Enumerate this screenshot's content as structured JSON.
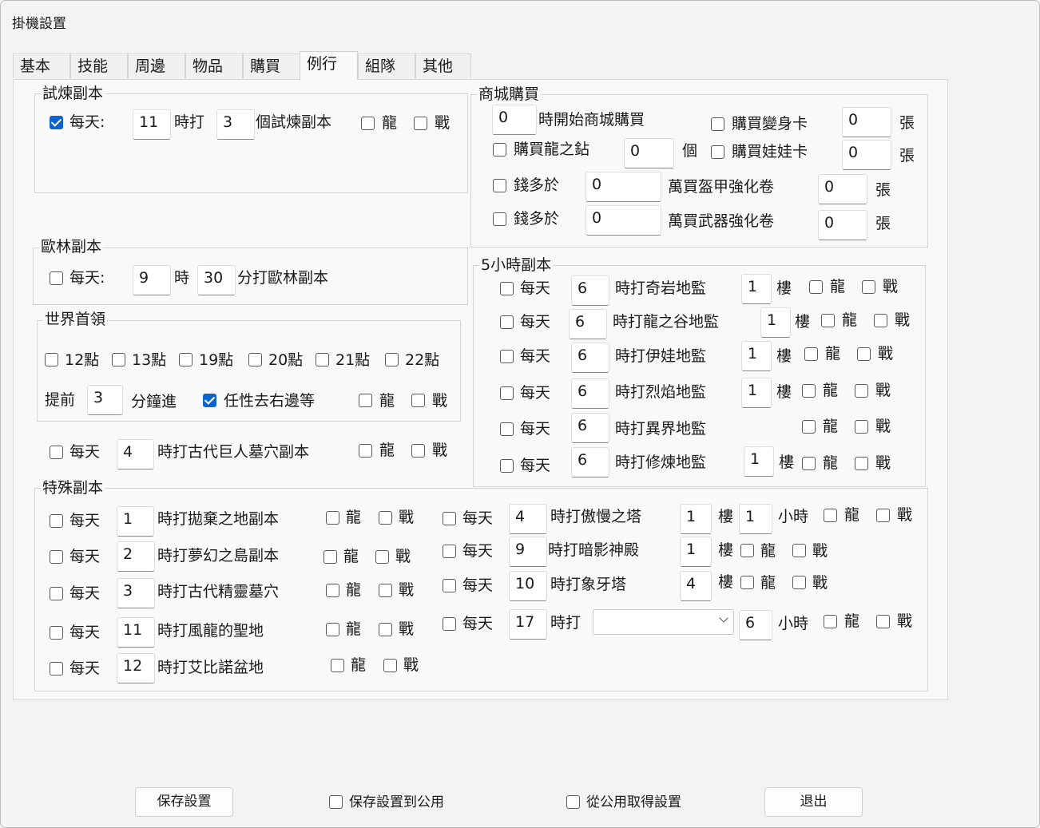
{
  "window": {
    "title": "掛機設置"
  },
  "tabs": [
    "基本",
    "技能",
    "周邊",
    "物品",
    "購買",
    "例行",
    "組隊",
    "其他"
  ],
  "trial": {
    "title": "試煉副本",
    "daily_label": "每天:",
    "daily_checked": true,
    "hour": "11",
    "mid": "時打",
    "count": "3",
    "suffix": "個試煉副本",
    "dragon": "龍",
    "war": "戰"
  },
  "orin": {
    "title": "歐林副本",
    "daily_label": "每天:",
    "hour": "9",
    "shi": "時",
    "minute": "30",
    "suffix": "分打歐林副本"
  },
  "world_boss": {
    "title": "世界首領",
    "times": [
      "12點",
      "13點",
      "19點",
      "20點",
      "21點",
      "22點"
    ],
    "advance_label": "提前",
    "advance_min": "3",
    "advance_suffix": "分鐘進",
    "random_label": "任性去右邊等",
    "random_checked": true,
    "dragon": "龍",
    "war": "戰"
  },
  "giant": {
    "daily": "每天",
    "hour": "4",
    "text": "時打古代巨人墓穴副本",
    "dragon": "龍",
    "war": "戰"
  },
  "shop": {
    "title": "商城購買",
    "start_hour": "0",
    "start_text": "時開始商城購買",
    "buy_transform": "購買變身卡",
    "transform_qty": "0",
    "zhang": "張",
    "buy_diamond": "購買龍之鉆",
    "diamond_qty": "0",
    "ge": "個",
    "buy_doll": "購買娃娃卡",
    "doll_qty": "0",
    "money_more": "錢多於",
    "armor_money": "0",
    "armor_text": "萬買盔甲強化卷",
    "armor_qty": "0",
    "weapon_money": "0",
    "weapon_text": "萬買武器強化卷",
    "weapon_qty": "0"
  },
  "five_hour": {
    "title": "5小時副本",
    "daily": "每天",
    "floor": "樓",
    "dragon": "龍",
    "war": "戰",
    "rows": [
      {
        "hour": "6",
        "text": "時打奇岩地監",
        "floor_val": "1"
      },
      {
        "hour": "6",
        "text": "時打龍之谷地監",
        "floor_val": "1"
      },
      {
        "hour": "6",
        "text": "時打伊娃地監",
        "floor_val": "1"
      },
      {
        "hour": "6",
        "text": "時打烈焰地監",
        "floor_val": "1"
      },
      {
        "hour": "6",
        "text": "時打異界地監",
        "floor_val": ""
      },
      {
        "hour": "6",
        "text": "時打修煉地監",
        "floor_val": "1"
      }
    ]
  },
  "special": {
    "title": "特殊副本",
    "daily": "每天",
    "dragon": "龍",
    "war": "戰",
    "floor": "樓",
    "hours_unit": "小時",
    "left": [
      {
        "hour": "1",
        "text": "時打拋棄之地副本"
      },
      {
        "hour": "2",
        "text": "時打夢幻之島副本"
      },
      {
        "hour": "3",
        "text": "時打古代精靈墓穴"
      },
      {
        "hour": "11",
        "text": "時打風龍的聖地"
      },
      {
        "hour": "12",
        "text": "時打艾比諾盆地"
      }
    ],
    "right": [
      {
        "hour": "4",
        "text": "時打傲慢之塔",
        "floor_val": "1",
        "hrs": "1"
      },
      {
        "hour": "9",
        "text": "時打暗影神殿",
        "floor_val": "1"
      },
      {
        "hour": "10",
        "text": "時打象牙塔",
        "floor_val": "4"
      },
      {
        "hour": "17",
        "text": "時打",
        "combo": "",
        "hrs": "6"
      }
    ]
  },
  "footer": {
    "save": "保存設置",
    "save_public": "保存設置到公用",
    "load_public": "從公用取得設置",
    "exit": "退出"
  }
}
